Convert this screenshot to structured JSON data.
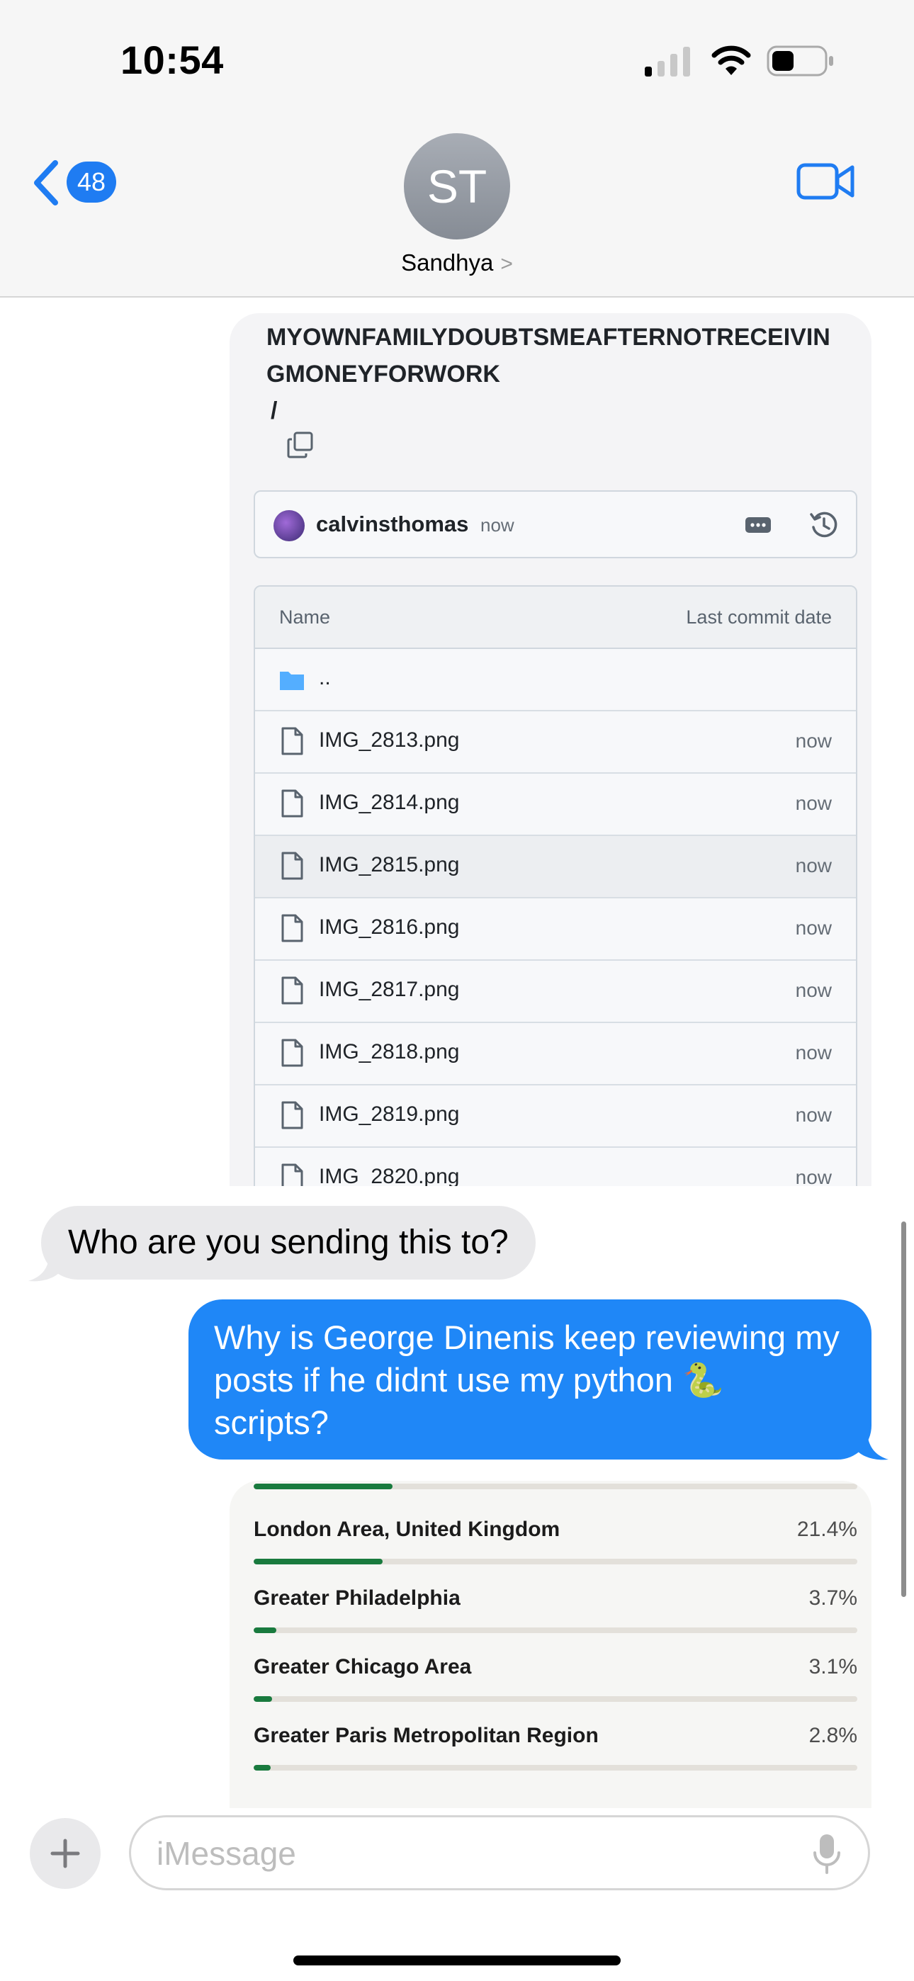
{
  "status_bar": {
    "time": "10:54"
  },
  "header": {
    "back_count": "48",
    "avatar_initials": "ST",
    "contact_name": "Sandhya",
    "contact_chevron": ">"
  },
  "repo_card": {
    "path": "MYOWNFAMILYDOUBTSMEAFTERNOTRECEIVINGMONEYFORWORK",
    "path_separator": "/",
    "commit": {
      "user": "calvinsthomas",
      "time": "now"
    },
    "table": {
      "col_name": "Name",
      "col_date": "Last commit date",
      "parent_dir": "..",
      "files": [
        {
          "name": "IMG_2813.png",
          "date": "now"
        },
        {
          "name": "IMG_2814.png",
          "date": "now"
        },
        {
          "name": "IMG_2815.png",
          "date": "now"
        },
        {
          "name": "IMG_2816.png",
          "date": "now"
        },
        {
          "name": "IMG_2817.png",
          "date": "now"
        },
        {
          "name": "IMG_2818.png",
          "date": "now"
        },
        {
          "name": "IMG_2819.png",
          "date": "now"
        },
        {
          "name": "IMG_2820.png",
          "date": "now"
        }
      ]
    }
  },
  "messages": {
    "received": "Who are you sending this to?",
    "sent": "Why is George Dinenis keep reviewing my posts if he didnt use my python 🐍 scripts?"
  },
  "stats_card": {
    "top_bar_fill": 0.23,
    "locations": [
      {
        "name": "London Area, United Kingdom",
        "pct": "21.4%",
        "fill": 0.214
      },
      {
        "name": "Greater Philadelphia",
        "pct": "3.7%",
        "fill": 0.037
      },
      {
        "name": "Greater Chicago Area",
        "pct": "3.1%",
        "fill": 0.031
      },
      {
        "name": "Greater Paris Metropolitan Region",
        "pct": "2.8%",
        "fill": 0.028
      }
    ]
  },
  "composer": {
    "placeholder": "iMessage"
  },
  "colors": {
    "imessage_blue": "#1f87f7",
    "badge_blue": "#1f7cf2",
    "bar_green": "#197a3e"
  }
}
